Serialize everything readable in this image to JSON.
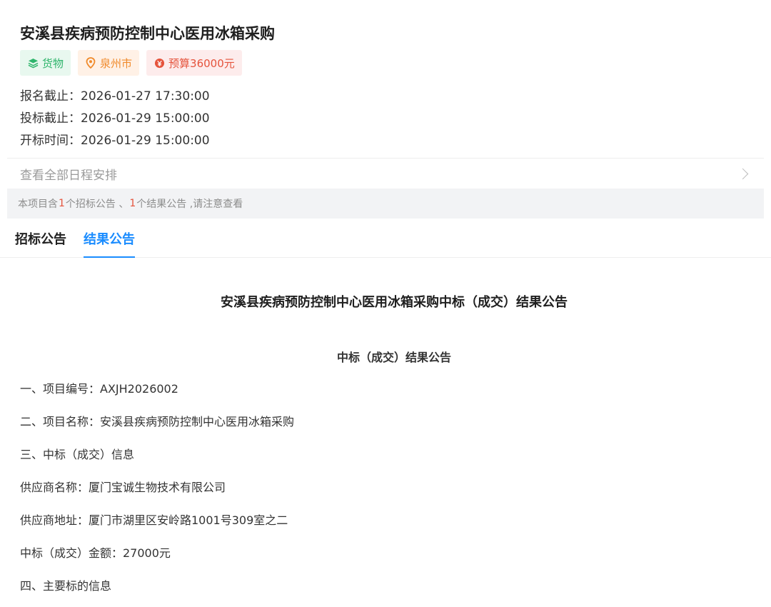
{
  "project": {
    "title": "安溪县疾病预防控制中心医用冰箱采购",
    "tags": {
      "category": "货物",
      "city": "泉州市",
      "budget": "预算36000元"
    }
  },
  "schedule": {
    "signup_label": "报名截止：",
    "signup_value": "2026-01-27 17:30:00",
    "bid_label": "投标截止：",
    "bid_value": "2026-01-29 15:00:00",
    "open_label": "开标时间：",
    "open_value": "2026-01-29 15:00:00",
    "view_all": "查看全部日程安排"
  },
  "notice": {
    "prefix": "本项目含",
    "tender_count": "1",
    "tender_text": "个招标公告 、",
    "result_count": "1",
    "result_text": "个结果公告 ,请注意查看"
  },
  "tabs": [
    {
      "label": "招标公告",
      "active": false
    },
    {
      "label": "结果公告",
      "active": true
    }
  ],
  "article": {
    "title": "安溪县疾病预防控制中心医用冰箱采购中标（成交）结果公告",
    "subtitle": "中标（成交）结果公告",
    "lines": [
      "一、项目编号：AXJH2026002",
      "二、项目名称：安溪县疾病预防控制中心医用冰箱采购",
      "三、中标（成交）信息",
      "供应商名称：厦门宝诚生物技术有限公司",
      "供应商地址：厦门市湖里区安岭路1001号309室之二",
      "中标（成交）金额：27000元",
      "四、主要标的信息"
    ]
  },
  "icons": {
    "category": "layers-icon",
    "city": "location-pin-icon",
    "budget": "yen-coin-icon",
    "view_all": "chevron-right-icon"
  },
  "colors": {
    "accent": "#1a8cff",
    "green": "#2fb56c",
    "orange": "#f08a2b",
    "red": "#e5533c"
  }
}
